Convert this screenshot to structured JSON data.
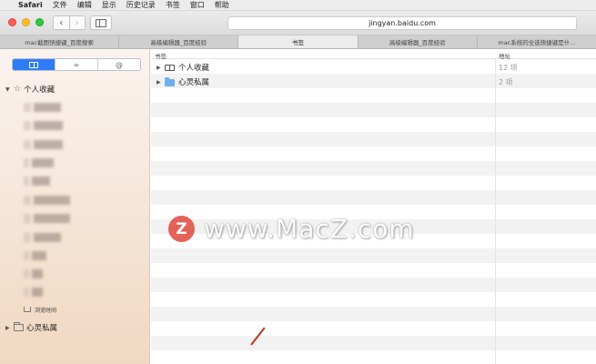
{
  "menubar": {
    "apple": "",
    "app": "Safari",
    "items": [
      "文件",
      "编辑",
      "显示",
      "历史记录",
      "书签",
      "窗口",
      "帮助"
    ]
  },
  "toolbar": {
    "back": "‹",
    "forward": "›",
    "address": "jingyan.baidu.com"
  },
  "tabs": [
    "mac截图快捷键_百度搜索",
    "高级编辑器_百度经验",
    "书签",
    "高级编辑器_百度经验",
    "mac系统的全选快捷键是什..."
  ],
  "active_tab": 2,
  "sidebar": {
    "segments": [
      "book",
      "∞",
      "@"
    ],
    "favorites_label": "个人收藏",
    "small_item": "浏览时间",
    "spirit_label": "心灵私属"
  },
  "main": {
    "col_bookmark": "书签",
    "col_address": "地址",
    "rows": [
      {
        "name": "个人收藏",
        "addr": "12 项"
      },
      {
        "name": "心灵私属",
        "addr": "2 项"
      }
    ]
  },
  "watermark": {
    "logo": "Z",
    "text": "www.MacZ.com"
  },
  "colors": {
    "accent": "#2f7cf6",
    "folder": "#6ab1ee",
    "watermark_logo": "#e04a3c"
  }
}
